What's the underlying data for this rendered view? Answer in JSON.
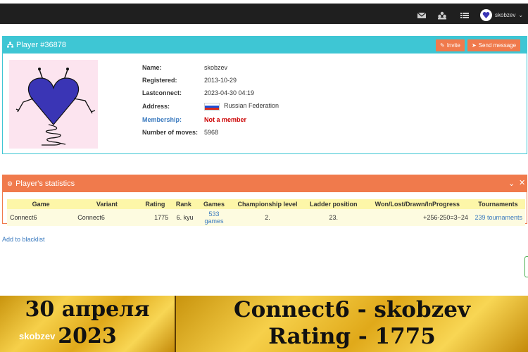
{
  "topbar": {
    "icons": [
      "envelope-icon",
      "users-icon",
      "list-icon"
    ],
    "username": "skobzev"
  },
  "player": {
    "title": "Player #36878",
    "invite_label": "Invite",
    "send_label": "Send message",
    "fields": {
      "name_label": "Name:",
      "name": "skobzev",
      "registered_label": "Registered:",
      "registered": "2013-10-29",
      "lastconnect_label": "Lastconnect:",
      "lastconnect": "2023-04-30 04:19",
      "address_label": "Address:",
      "address": "Russian Federation",
      "membership_label": "Membership:",
      "membership": "Not a member",
      "moves_label": "Number of moves:",
      "moves": "5968"
    }
  },
  "stats": {
    "title": "Player's statistics",
    "headers": [
      "Game",
      "Variant",
      "Rating",
      "Rank",
      "Games",
      "Championship level",
      "Ladder position",
      "Won/Lost/Drawn/InProgress",
      "Tournaments"
    ],
    "row": [
      "Connect6",
      "Connect6",
      "1775",
      "6. kyu",
      "533 games",
      "2.",
      "23.",
      "+256-250=3~24",
      "239 tournaments"
    ]
  },
  "blacklist_label": "Add to blacklist",
  "banner": {
    "date_line1": "30 апреля",
    "date_line2": "2023",
    "watermark": "skobzev",
    "title_line1": "Connect6 - skobzev",
    "title_line2": "Rating - 1775"
  },
  "colors": {
    "teal": "#3ec6d4",
    "orange": "#f07a4c",
    "link": "#3a7abf"
  }
}
